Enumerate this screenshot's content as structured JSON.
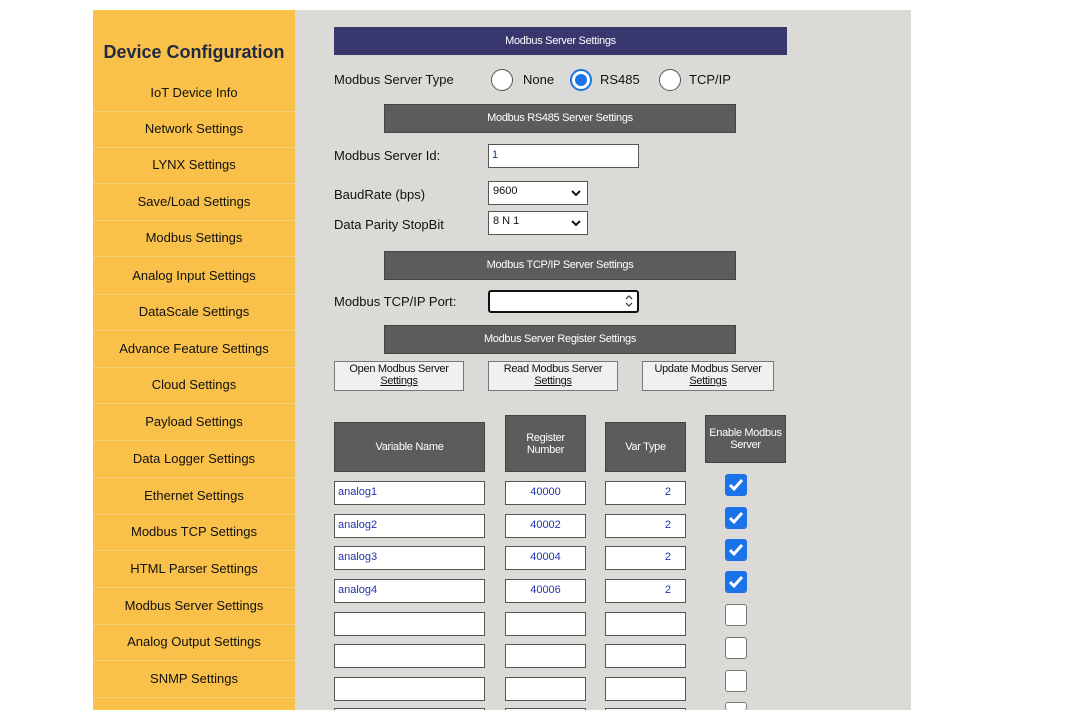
{
  "sidebar": {
    "title": "Device Configuration",
    "items": [
      {
        "label": "IoT Device Info"
      },
      {
        "label": "Network Settings"
      },
      {
        "label": "LYNX Settings"
      },
      {
        "label": "Save/Load Settings"
      },
      {
        "label": "Modbus Settings"
      },
      {
        "label": "Analog Input Settings"
      },
      {
        "label": "DataScale Settings"
      },
      {
        "label": "Advance Feature Settings"
      },
      {
        "label": "Cloud Settings"
      },
      {
        "label": "Payload Settings"
      },
      {
        "label": "Data Logger Settings"
      },
      {
        "label": "Ethernet Settings"
      },
      {
        "label": "Modbus TCP Settings"
      },
      {
        "label": "HTML Parser Settings"
      },
      {
        "label": "Modbus Server Settings"
      },
      {
        "label": "Analog Output Settings"
      },
      {
        "label": "SNMP Settings"
      }
    ]
  },
  "main": {
    "header": "Modbus Server Settings",
    "server_type": {
      "label": "Modbus Server Type",
      "options": [
        "None",
        "RS485",
        "TCP/IP"
      ],
      "selected": "RS485"
    },
    "rs485": {
      "header": "Modbus RS485 Server Settings",
      "server_id_label": "Modbus Server Id:",
      "server_id_value": "1",
      "baud_label": "BaudRate (bps)",
      "baud_value": "9600",
      "parity_label": "Data Parity StopBit",
      "parity_value": "8 N 1"
    },
    "tcpip": {
      "header": "Modbus TCP/IP Server Settings",
      "port_label": "Modbus TCP/IP Port:",
      "port_value": ""
    },
    "registers": {
      "header": "Modbus Server Register Settings",
      "buttons": [
        {
          "line1": "Open Modbus Server",
          "line2": "Settings"
        },
        {
          "line1": "Read Modbus Server",
          "line2": "Settings"
        },
        {
          "line1": "Update Modbus Server",
          "line2": "Settings"
        }
      ],
      "columns": {
        "variable": "Variable Name",
        "register_1": "Register",
        "register_2": "Number",
        "vartype": "Var Type",
        "enable_1": "Enable Modbus",
        "enable_2": "Server"
      },
      "rows": [
        {
          "name": "analog1",
          "register": "40000",
          "type": "2",
          "enabled": true
        },
        {
          "name": "analog2",
          "register": "40002",
          "type": "2",
          "enabled": true
        },
        {
          "name": "analog3",
          "register": "40004",
          "type": "2",
          "enabled": true
        },
        {
          "name": "analog4",
          "register": "40006",
          "type": "2",
          "enabled": true
        },
        {
          "name": "",
          "register": "",
          "type": "",
          "enabled": false
        },
        {
          "name": "",
          "register": "",
          "type": "",
          "enabled": false
        },
        {
          "name": "",
          "register": "",
          "type": "",
          "enabled": false
        }
      ]
    }
  },
  "colors": {
    "sidebar_bg": "#f9c14a",
    "header_navy": "#38386e",
    "section_gray": "#5c5c5c",
    "main_bg": "#dcdad6",
    "accent_blue": "#1a73e8"
  },
  "icons": {
    "dropdown": "chevron-down-icon",
    "checkbox": "checkmark-icon",
    "spinner": "spinner-arrows-icon"
  }
}
